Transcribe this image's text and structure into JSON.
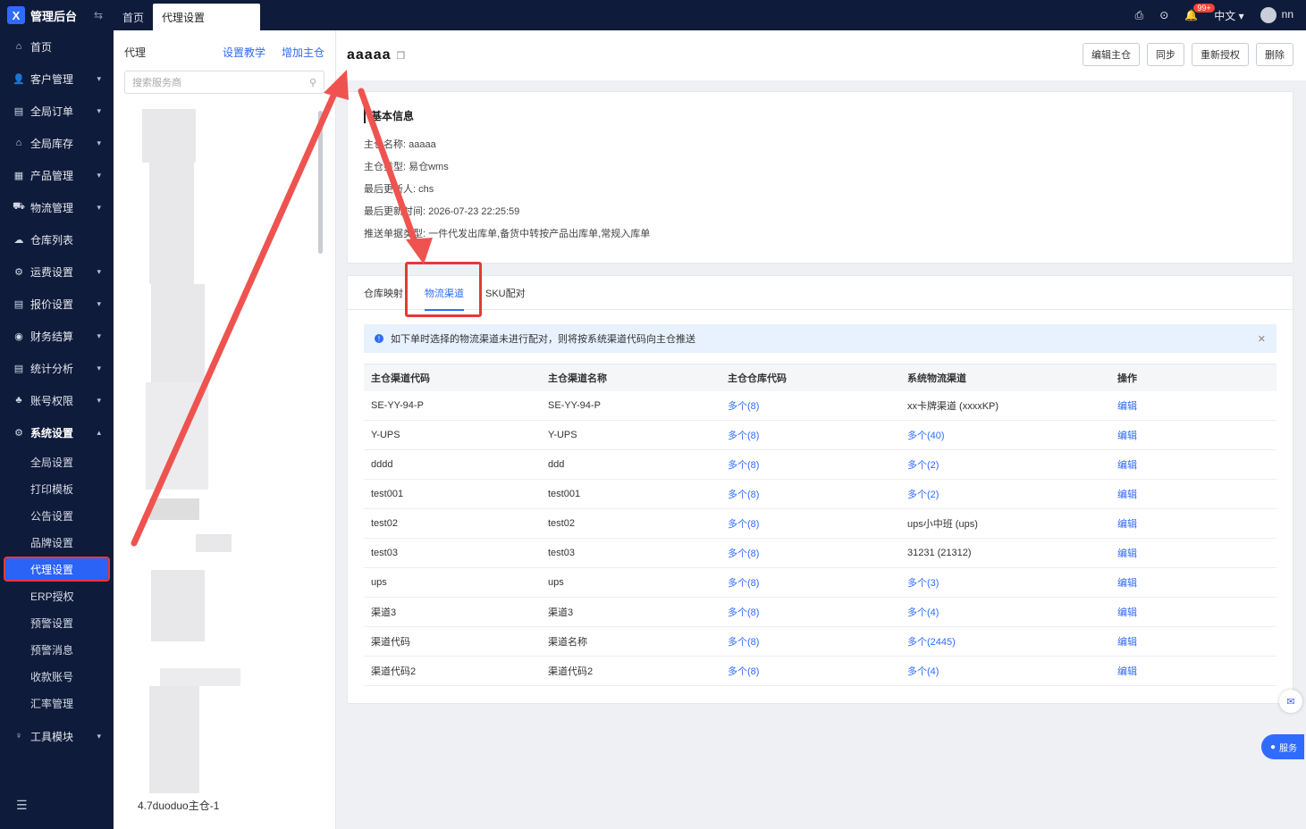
{
  "sidebar": {
    "logo": "管理后台",
    "collapse": "⇆",
    "items": [
      {
        "label": "首页",
        "icon": "⌂",
        "chev": ""
      },
      {
        "label": "客户管理",
        "icon": "👤",
        "chev": "▾"
      },
      {
        "label": "全局订单",
        "icon": "▤",
        "chev": "▾"
      },
      {
        "label": "全局库存",
        "icon": "⌂",
        "chev": "▾"
      },
      {
        "label": "产品管理",
        "icon": "▦",
        "chev": "▾"
      },
      {
        "label": "物流管理",
        "icon": "⛟",
        "chev": "▾"
      },
      {
        "label": "仓库列表",
        "icon": "☁",
        "chev": ""
      },
      {
        "label": "运费设置",
        "icon": "⚙",
        "chev": "▾"
      },
      {
        "label": "报价设置",
        "icon": "▤",
        "chev": "▾"
      },
      {
        "label": "财务结算",
        "icon": "◉",
        "chev": "▾"
      },
      {
        "label": "统计分析",
        "icon": "▤",
        "chev": "▾"
      },
      {
        "label": "账号权限",
        "icon": "♣",
        "chev": "▾"
      },
      {
        "label": "系统设置",
        "icon": "⚙",
        "chev": "▴"
      }
    ],
    "sub": [
      "全局设置",
      "打印模板",
      "公告设置",
      "品牌设置",
      "代理设置",
      "ERP授权",
      "预警设置",
      "预警消息",
      "收款账号",
      "汇率管理"
    ],
    "tools": {
      "label": "工具模块",
      "icon": "♀",
      "chev": "▾"
    },
    "bottom": "☰"
  },
  "topbar": {
    "tabs": [
      "首页",
      "代理设置"
    ],
    "badge": "99+",
    "lang": "中文 ▾",
    "user": "nn",
    "icons": [
      "printer-icon",
      "download-icon",
      "bell-icon"
    ]
  },
  "agent": {
    "title": "代理",
    "link1": "设置教学",
    "link2": "增加主仓",
    "search_placeholder": "搜索服务商",
    "last_item": "4.7duoduo主仓-1"
  },
  "main": {
    "title": "aaaaa",
    "buttons": [
      "编辑主仓",
      "同步",
      "重新授权",
      "删除"
    ],
    "info_title": "基本信息",
    "info_rows": [
      "主仓名称:  aaaaa",
      "主仓类型:  易仓wms",
      "最后更新人:  chs",
      "最后更新时间:  2026-07-23 22:25:59",
      "推送单据类型:  一件代发出库单,备货中转按产品出库单,常规入库单"
    ],
    "tabs": [
      "仓库映射",
      "物流渠道",
      "SKU配对"
    ],
    "notice": "如下单时选择的物流渠道未进行配对，则将按系统渠道代码向主仓推送",
    "columns": [
      "主仓渠道代码",
      "主仓渠道名称",
      "主仓仓库代码",
      "系统物流渠道",
      "操作"
    ],
    "rows": [
      [
        "SE-YY-94-P",
        "SE-YY-94-P",
        "多个(8)",
        "xx卡牌渠道 (xxxxKP)",
        "编辑"
      ],
      [
        "Y-UPS",
        "Y-UPS",
        "多个(8)",
        "多个(40)",
        "编辑"
      ],
      [
        "dddd",
        "ddd",
        "多个(8)",
        "多个(2)",
        "编辑"
      ],
      [
        "test001",
        "test001",
        "多个(8)",
        "多个(2)",
        "编辑"
      ],
      [
        "test02",
        "test02",
        "多个(8)",
        "ups小中班 (ups)",
        "编辑"
      ],
      [
        "test03",
        "test03",
        "多个(8)",
        "31231 (21312)",
        "编辑"
      ],
      [
        "ups",
        "ups",
        "多个(8)",
        "多个(3)",
        "编辑"
      ],
      [
        "渠道3",
        "渠道3",
        "多个(8)",
        "多个(4)",
        "编辑"
      ],
      [
        "渠道代码",
        "渠道名称",
        "多个(8)",
        "多个(2445)",
        "编辑"
      ],
      [
        "渠道代码2",
        "渠道代码2",
        "多个(8)",
        "多个(4)",
        "编辑"
      ]
    ],
    "float_service": "服务"
  },
  "colors": {
    "sidebar": "#0f1b3a",
    "accent": "#2f6bff",
    "highlight": "#e53935"
  }
}
